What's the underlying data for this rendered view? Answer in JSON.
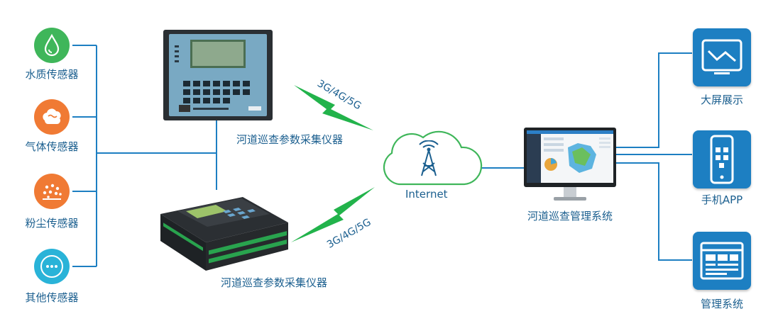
{
  "sensors": [
    {
      "label": "水质传感器",
      "color": "#3fb65a",
      "icon": "water-drop-icon"
    },
    {
      "label": "气体传感器",
      "color": "#f07a34",
      "icon": "gas-cloud-icon"
    },
    {
      "label": "粉尘传感器",
      "color": "#f07a34",
      "icon": "dust-particles-icon"
    },
    {
      "label": "其他传感器",
      "color": "#29b3d8",
      "icon": "more-dots-icon"
    }
  ],
  "collectors": {
    "top_label": "河道巡查参数采集仪器",
    "bottom_label": "河道巡查参数采集仪器"
  },
  "network": {
    "top_link": "3G/4G/5G",
    "bottom_link": "3G/4G/5G",
    "cloud_label": "Internet",
    "cloud_icon": "signal-tower-icon"
  },
  "system": {
    "label": "河道巡查管理系统"
  },
  "outputs": [
    {
      "label": "大屏展示",
      "icon": "monitor-chart-icon"
    },
    {
      "label": "手机APP",
      "icon": "mobile-app-icon"
    },
    {
      "label": "管理系统",
      "icon": "management-console-icon"
    }
  ],
  "colors": {
    "line": "#1d7fc2",
    "bolt": "#22b34b",
    "tile": "#1d7fc2",
    "text": "#1b5f8f"
  }
}
